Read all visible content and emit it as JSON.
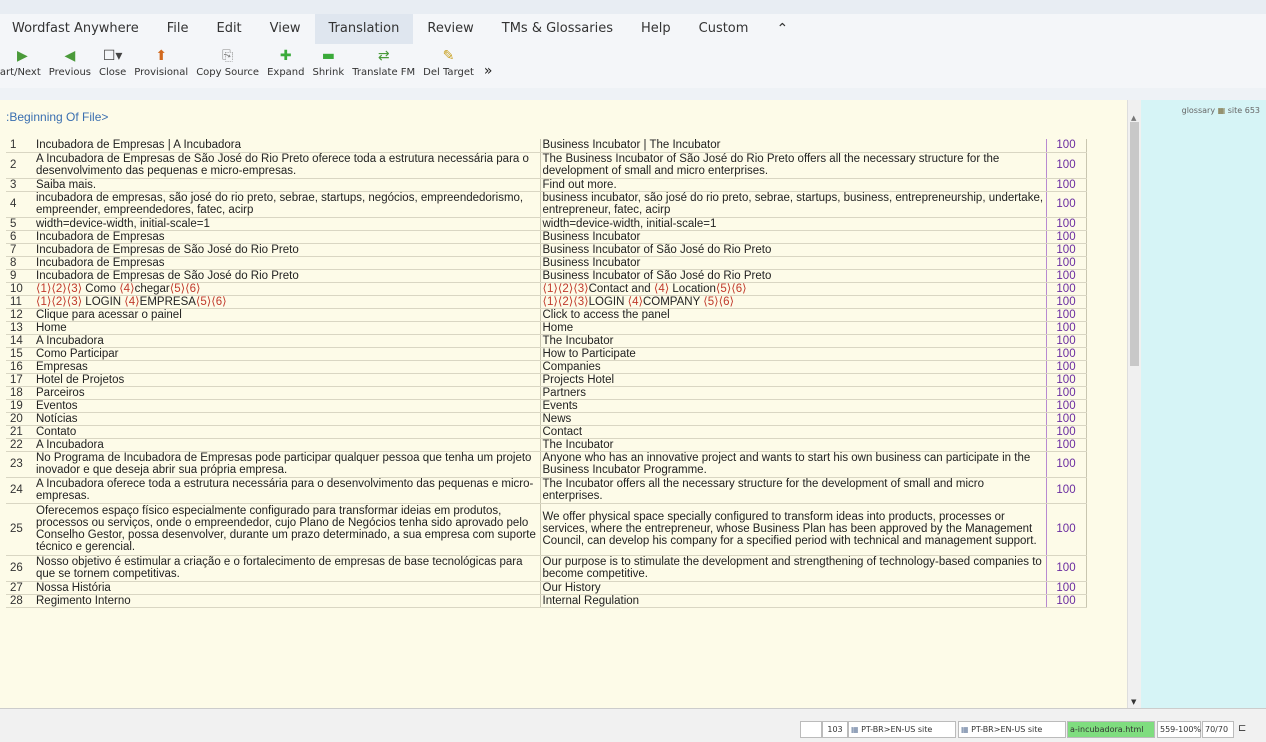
{
  "menu": {
    "items": [
      "Wordfast Anywhere",
      "File",
      "Edit",
      "View",
      "Translation",
      "Review",
      "TMs & Glossaries",
      "Help",
      "Custom"
    ],
    "active_index": 4,
    "collapse_glyph": "⌃"
  },
  "toolbar": {
    "buttons": [
      {
        "label": "tart/Next",
        "icon": "start-next-icon",
        "glyph": "▶",
        "color": "#4a9a3a"
      },
      {
        "label": "Previous",
        "icon": "previous-icon",
        "glyph": "◀",
        "color": "#4a9a3a"
      },
      {
        "label": "Close",
        "icon": "close-segment-icon",
        "glyph": "☐▾",
        "color": "#444444"
      },
      {
        "label": "Provisional",
        "icon": "provisional-icon",
        "glyph": "⬆",
        "color": "#d2691e"
      },
      {
        "label": "Copy Source",
        "icon": "copy-source-icon",
        "glyph": "⎘",
        "color": "#888888"
      },
      {
        "label": "Expand",
        "icon": "expand-icon",
        "glyph": "✚",
        "color": "#3aaa3a"
      },
      {
        "label": "Shrink",
        "icon": "shrink-icon",
        "glyph": "▬",
        "color": "#3aaa3a"
      },
      {
        "label": "Translate FM",
        "icon": "translate-fm-icon",
        "glyph": "⇄",
        "color": "#4a9a3a"
      },
      {
        "label": "Del Target",
        "icon": "del-target-icon",
        "glyph": "✎",
        "color": "#c8a020"
      }
    ],
    "more_glyph": "»"
  },
  "editor": {
    "beginning_label": ":Beginning Of File>",
    "segments": [
      {
        "n": "1",
        "src": "Incubadora de Empresas | A Incubadora",
        "tgt": "Business Incubator | The Incubator",
        "score": "100",
        "lines": 1
      },
      {
        "n": "2",
        "src": "A Incubadora de Empresas de São José do Rio Preto oferece toda a estrutura necessária para o desenvolvimento das pequenas e micro-empresas.",
        "tgt": "The Business Incubator of São José do Rio Preto offers all the necessary structure for the development of small and micro enterprises.",
        "score": "100",
        "lines": 2
      },
      {
        "n": "3",
        "src": "Saiba mais.",
        "tgt": "Find out more.",
        "score": "100",
        "lines": 1
      },
      {
        "n": "4",
        "src": "incubadora de empresas, são josé do rio preto, sebrae, startups, negócios, empreendedorismo, empreender, empreendedores, fatec, acirp",
        "tgt": "business incubator, são josé do rio preto, sebrae, startups, business, entrepreneurship, undertake, entrepreneur, fatec, acirp",
        "score": "100",
        "lines": 2
      },
      {
        "n": "5",
        "src": "width=device-width, initial-scale=1",
        "tgt": "width=device-width, initial-scale=1",
        "score": "100",
        "lines": 1
      },
      {
        "n": "6",
        "src": "Incubadora de Empresas",
        "tgt": "Business Incubator",
        "score": "100",
        "lines": 1
      },
      {
        "n": "7",
        "src": "Incubadora de Empresas de São José do Rio Preto",
        "tgt": "Business Incubator of São José do Rio Preto",
        "score": "100",
        "lines": 1
      },
      {
        "n": "8",
        "src": "Incubadora de Empresas",
        "tgt": "Business Incubator",
        "score": "100",
        "lines": 1
      },
      {
        "n": "9",
        "src": "Incubadora de Empresas de São José do Rio Preto",
        "tgt": "Business Incubator of São José do Rio Preto",
        "score": "100",
        "lines": 1
      },
      {
        "n": "10",
        "src_pre": "⟨1⟩⟨2⟩⟨3⟩",
        "src": " Como ",
        "src_mid": "⟨4⟩",
        "src2": "chegar",
        "src_post": "⟨5⟩⟨6⟩",
        "tgt_pre": "⟨1⟩⟨2⟩⟨3⟩",
        "tgt": "Contact and ",
        "tgt_mid": "⟨4⟩",
        "tgt2": " Location",
        "tgt_post": "⟨5⟩⟨6⟩",
        "score": "100",
        "lines": 1
      },
      {
        "n": "11",
        "src_pre": "⟨1⟩⟨2⟩⟨3⟩",
        "src": " LOGIN ",
        "src_mid": "⟨4⟩",
        "src2": "EMPRESA",
        "src_post": "⟨5⟩⟨6⟩",
        "tgt_pre": "⟨1⟩⟨2⟩⟨3⟩",
        "tgt": "LOGIN ",
        "tgt_mid": "⟨4⟩",
        "tgt2": "COMPANY ",
        "tgt_post": "⟨5⟩⟨6⟩",
        "score": "100",
        "lines": 1
      },
      {
        "n": "12",
        "src": "Clique para acessar o painel",
        "tgt": "Click to access the panel",
        "score": "100",
        "lines": 1
      },
      {
        "n": "13",
        "src": "Home",
        "tgt": "Home",
        "score": "100",
        "lines": 1
      },
      {
        "n": "14",
        "src": "A Incubadora",
        "tgt": "The Incubator",
        "score": "100",
        "lines": 1
      },
      {
        "n": "15",
        "src": "Como Participar",
        "tgt": "How to Participate",
        "score": "100",
        "lines": 1
      },
      {
        "n": "16",
        "src": "Empresas",
        "tgt": "Companies",
        "score": "100",
        "lines": 1
      },
      {
        "n": "17",
        "src": "Hotel de Projetos",
        "tgt": "Projects Hotel",
        "score": "100",
        "lines": 1
      },
      {
        "n": "18",
        "src": "Parceiros",
        "tgt": "Partners",
        "score": "100",
        "lines": 1
      },
      {
        "n": "19",
        "src": "Eventos",
        "tgt": "Events",
        "score": "100",
        "lines": 1
      },
      {
        "n": "20",
        "src": "Notícias",
        "tgt": "News",
        "score": "100",
        "lines": 1
      },
      {
        "n": "21",
        "src": "Contato",
        "tgt": "Contact",
        "score": "100",
        "lines": 1
      },
      {
        "n": "22",
        "src": "A Incubadora",
        "tgt": "The Incubator",
        "score": "100",
        "lines": 1
      },
      {
        "n": "23",
        "src": "No Programa de Incubadora de Empresas pode participar qualquer pessoa que tenha um projeto inovador e que deseja abrir sua própria empresa.",
        "tgt": "Anyone who has an innovative project and wants to start his own business can participate in the Business Incubator Programme.",
        "score": "100",
        "lines": 2
      },
      {
        "n": "24",
        "src": "A Incubadora oferece toda a estrutura necessária para o desenvolvimento das pequenas e micro-empresas.",
        "tgt": "The Incubator offers all the necessary structure for the development of small and micro enterprises.",
        "score": "100",
        "lines": 2
      },
      {
        "n": "25",
        "src": "Oferecemos espaço físico especialmente configurado para transformar ideias em produtos, processos ou serviços, onde o empreendedor, cujo Plano de Negócios tenha sido aprovado pelo Conselho Gestor, possa desenvolver, durante um prazo determinado, a sua empresa com suporte técnico e gerencial.",
        "tgt": "We offer physical space specially configured to transform ideas into products, processes or services, where the entrepreneur, whose Business Plan has been approved by the Management Council, can develop his company for a specified period with technical and management support.",
        "score": "100",
        "lines": 4
      },
      {
        "n": "26",
        "src": "Nosso objetivo é estimular a criação e o fortalecimento de empresas de base tecnológicas para que se tornem competitivas.",
        "tgt": "Our purpose is to stimulate the development and strengthening of technology-based companies to become competitive.",
        "score": "100",
        "lines": 2
      },
      {
        "n": "27",
        "src": "Nossa História",
        "tgt": "Our History",
        "score": "100",
        "lines": 1
      },
      {
        "n": "28",
        "src": "Regimento Interno",
        "tgt": "Internal Regulation",
        "score": "100",
        "lines": 1
      }
    ]
  },
  "side_panel": {
    "header_left": "glossary",
    "header_right": "site 653"
  },
  "status": {
    "count": "103",
    "tm1": "PT-BR>EN-US site",
    "tm2": "PT-BR>EN-US site",
    "file": "a-incubadora.html",
    "percent": "559-100%",
    "position": "70/70",
    "end_glyph": "⊏"
  }
}
